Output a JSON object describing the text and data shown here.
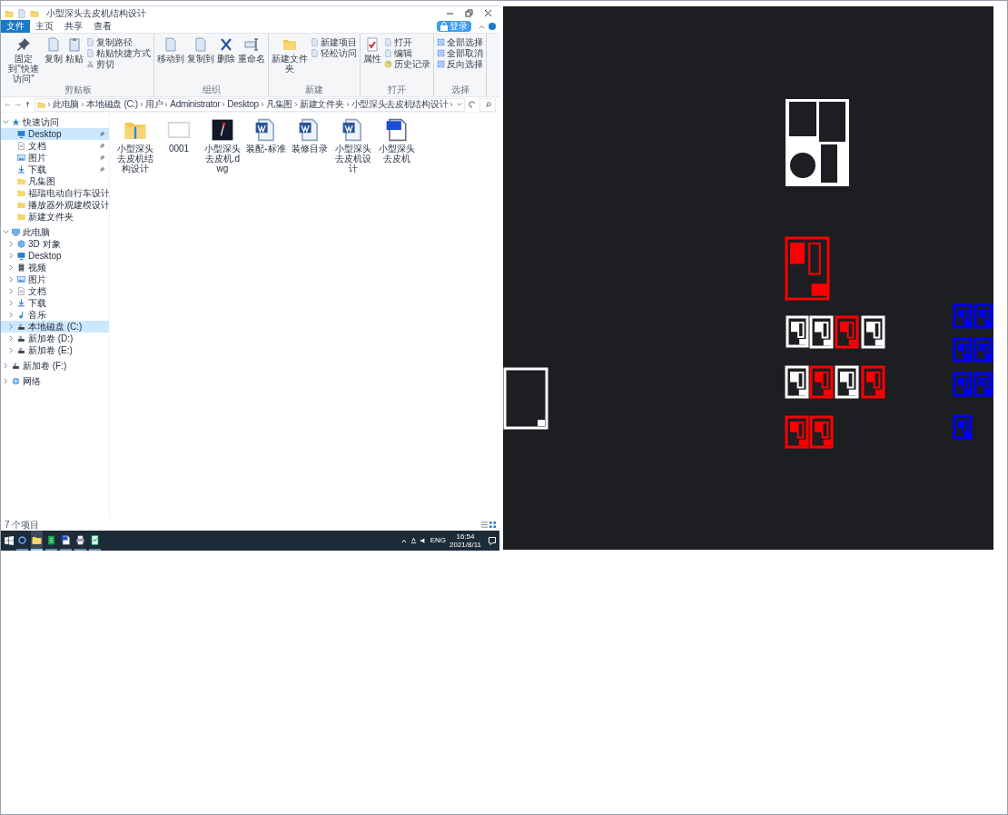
{
  "explorer": {
    "title": "小型深头去皮机结构设计",
    "ribbon_tabs": [
      {
        "label": "文件",
        "selected": true
      },
      {
        "label": "主页",
        "selected": false
      },
      {
        "label": "共享",
        "selected": false
      },
      {
        "label": "查看",
        "selected": false
      }
    ],
    "login_button": "登录",
    "ribbon_groups": [
      {
        "label": "剪贴板",
        "large": [
          {
            "label": "固定到\"快速访问\"",
            "kind": "pin"
          },
          {
            "label": "复制",
            "kind": "doc"
          },
          {
            "label": "粘贴",
            "kind": "clipboard"
          }
        ],
        "small": [
          {
            "label": "复制路径",
            "kind": "doc"
          },
          {
            "label": "粘贴快捷方式",
            "kind": "doc"
          },
          {
            "label": "剪切",
            "kind": "scissors"
          }
        ]
      },
      {
        "label": "组织",
        "large": [
          {
            "label": "移动到",
            "kind": "doc"
          },
          {
            "label": "复制到",
            "kind": "doc"
          },
          {
            "label": "删除",
            "kind": "x"
          },
          {
            "label": "重命名",
            "kind": "rename"
          }
        ]
      },
      {
        "label": "新建",
        "large": [
          {
            "label": "新建文件夹",
            "kind": "folder"
          }
        ],
        "small": [
          {
            "label": "新建项目",
            "kind": "doc"
          },
          {
            "label": "轻松访问",
            "kind": "doc"
          }
        ]
      },
      {
        "label": "打开",
        "large": [
          {
            "label": "属性",
            "kind": "check"
          }
        ],
        "small": [
          {
            "label": "打开",
            "kind": "doc"
          },
          {
            "label": "编辑",
            "kind": "doc"
          },
          {
            "label": "历史记录",
            "kind": "history"
          }
        ]
      },
      {
        "label": "选择",
        "small": [
          {
            "label": "全部选择",
            "kind": "select"
          },
          {
            "label": "全部取消",
            "kind": "select"
          },
          {
            "label": "反向选择",
            "kind": "select"
          }
        ]
      }
    ],
    "breadcrumbs": [
      "此电脑",
      "本地磁盘 (C:)",
      "用户",
      "Administrator",
      "Desktop",
      "凡集图",
      "新建文件夹",
      "小型深头去皮机结构设计"
    ],
    "sidebar": [
      {
        "label": "快速访问",
        "kind": "star",
        "expanded": true,
        "selected": false,
        "children": [
          {
            "label": "Desktop",
            "kind": "desktop",
            "pinned": true,
            "selected": true
          },
          {
            "label": "文档",
            "kind": "docs",
            "pinned": true,
            "selected": false
          },
          {
            "label": "图片",
            "kind": "pictures",
            "pinned": true,
            "selected": false
          },
          {
            "label": "下载",
            "kind": "download",
            "pinned": true,
            "selected": false
          },
          {
            "label": "凡集图",
            "kind": "folder",
            "pinned": false,
            "selected": false
          },
          {
            "label": "福瑞电动自行车设计",
            "kind": "folder",
            "pinned": false,
            "selected": false
          },
          {
            "label": "播放器外观建模设计",
            "kind": "folder",
            "pinned": false,
            "selected": false
          },
          {
            "label": "新建文件夹",
            "kind": "folder",
            "pinned": false,
            "selected": false
          }
        ]
      },
      {
        "label": "此电脑",
        "kind": "pc",
        "expanded": true,
        "selected": false,
        "children": [
          {
            "label": "3D 对象",
            "kind": "cube",
            "expanded": false,
            "selected": false
          },
          {
            "label": "Desktop",
            "kind": "desktop",
            "expanded": false,
            "selected": false
          },
          {
            "label": "视频",
            "kind": "video",
            "expanded": false,
            "selected": false
          },
          {
            "label": "图片",
            "kind": "pictures",
            "expanded": false,
            "selected": false
          },
          {
            "label": "文档",
            "kind": "docs",
            "expanded": false,
            "selected": false
          },
          {
            "label": "下载",
            "kind": "download",
            "expanded": false,
            "selected": false
          },
          {
            "label": "音乐",
            "kind": "music",
            "expanded": false,
            "selected": false
          },
          {
            "label": "本地磁盘 (C:)",
            "kind": "drive",
            "expanded": false,
            "selected": true
          },
          {
            "label": "新加卷 (D:)",
            "kind": "drive",
            "expanded": false,
            "selected": false
          },
          {
            "label": "新加卷 (E:)",
            "kind": "drive",
            "expanded": false,
            "selected": false
          }
        ]
      },
      {
        "label": "新加卷 (F:)",
        "kind": "drive",
        "expanded": false,
        "selected": false
      },
      {
        "label": "网络",
        "kind": "network",
        "expanded": false,
        "selected": false
      }
    ],
    "files": [
      {
        "name": "小型深头去皮机结构设计",
        "kind": "zipfolder"
      },
      {
        "name": "0001",
        "kind": "blank"
      },
      {
        "name": "小型深头去皮机.dwg",
        "kind": "dwg"
      },
      {
        "name": "装配-标准",
        "kind": "word"
      },
      {
        "name": "装修目录",
        "kind": "word"
      },
      {
        "name": "小型深头去皮机设计",
        "kind": "word"
      },
      {
        "name": "小型深头去皮机",
        "kind": "bluedoc"
      }
    ],
    "status": "7 个项目"
  },
  "taskbar": {
    "apps": [
      {
        "kind": "search",
        "active": false
      },
      {
        "kind": "folder",
        "active": true
      },
      {
        "kind": "sheet",
        "active": false
      },
      {
        "kind": "bluedoc",
        "active": false
      },
      {
        "kind": "printer",
        "active": false
      },
      {
        "kind": "greendoc",
        "active": false
      }
    ],
    "language": "ENG",
    "time": "16:54",
    "date": "2021/8/11"
  }
}
